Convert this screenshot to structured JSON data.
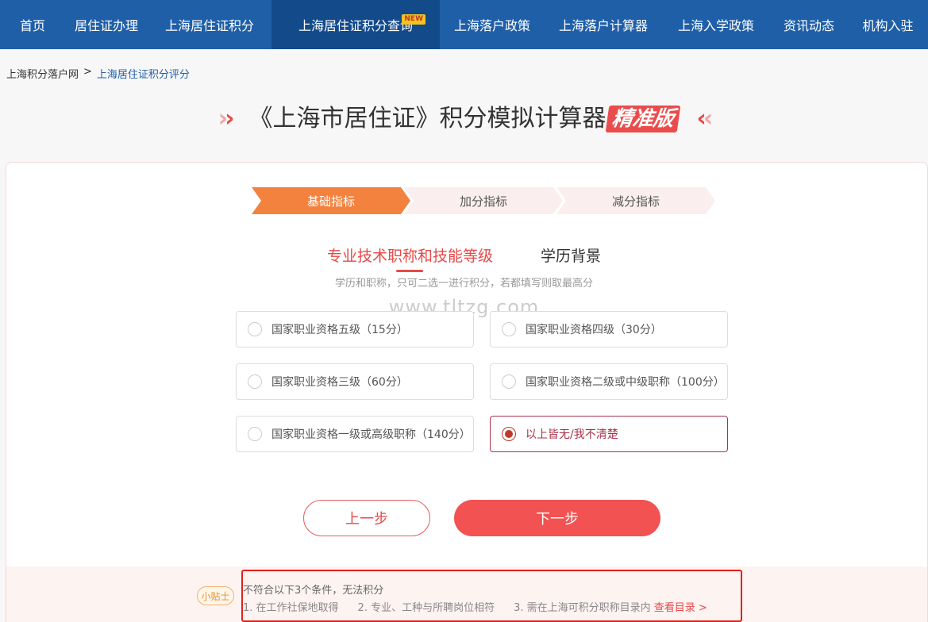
{
  "nav": {
    "items": [
      {
        "label": "首页"
      },
      {
        "label": "居住证办理"
      },
      {
        "label": "上海居住证积分"
      },
      {
        "label": "上海居住证积分查询",
        "badge": "NEW",
        "active": true
      },
      {
        "label": "上海落户政策"
      },
      {
        "label": "上海落户计算器"
      },
      {
        "label": "上海入学政策"
      },
      {
        "label": "资讯动态"
      },
      {
        "label": "机构入驻"
      }
    ]
  },
  "breadcrumb": {
    "home": "上海积分落户网",
    "separator": ">",
    "current": "上海居住证积分评分"
  },
  "header": {
    "left_arrows": "››",
    "title": "《上海市居住证》积分模拟计算器",
    "edition": "精准版",
    "right_arrows": "‹‹"
  },
  "steps": [
    {
      "label": "基础指标",
      "active": true
    },
    {
      "label": "加分指标",
      "active": false
    },
    {
      "label": "减分指标",
      "active": false
    }
  ],
  "subtabs": [
    {
      "label": "专业技术职称和技能等级",
      "active": true
    },
    {
      "label": "学历背景",
      "active": false
    }
  ],
  "hint": "学历和职称，只可二选一进行积分，若都填写则取最高分",
  "watermark": "www.tltzg.com",
  "options": [
    {
      "label": "国家职业资格五级（15分）",
      "selected": false
    },
    {
      "label": "国家职业资格四级（30分）",
      "selected": false
    },
    {
      "label": "国家职业资格三级（60分）",
      "selected": false
    },
    {
      "label": "国家职业资格二级或中级职称（100分）",
      "selected": false
    },
    {
      "label": "国家职业资格一级或高级职称（140分）",
      "selected": false
    },
    {
      "label": "以上皆无/我不清楚",
      "selected": true
    }
  ],
  "buttons": {
    "prev": "上一步",
    "next": "下一步"
  },
  "tips": {
    "badge": "小贴士",
    "title": "不符合以下3个条件，无法积分",
    "item1": "1. 在工作社保地取得",
    "item2": "2. 专业、工种与所聘岗位相符",
    "item3": "3. 需在上海可积分职称目录内",
    "link": "查看目录 >"
  },
  "colors": {
    "nav_bg": "#1f5fa8",
    "accent_red": "#e84848",
    "step_active": "#f3823f",
    "selected_border": "#a8324a"
  }
}
